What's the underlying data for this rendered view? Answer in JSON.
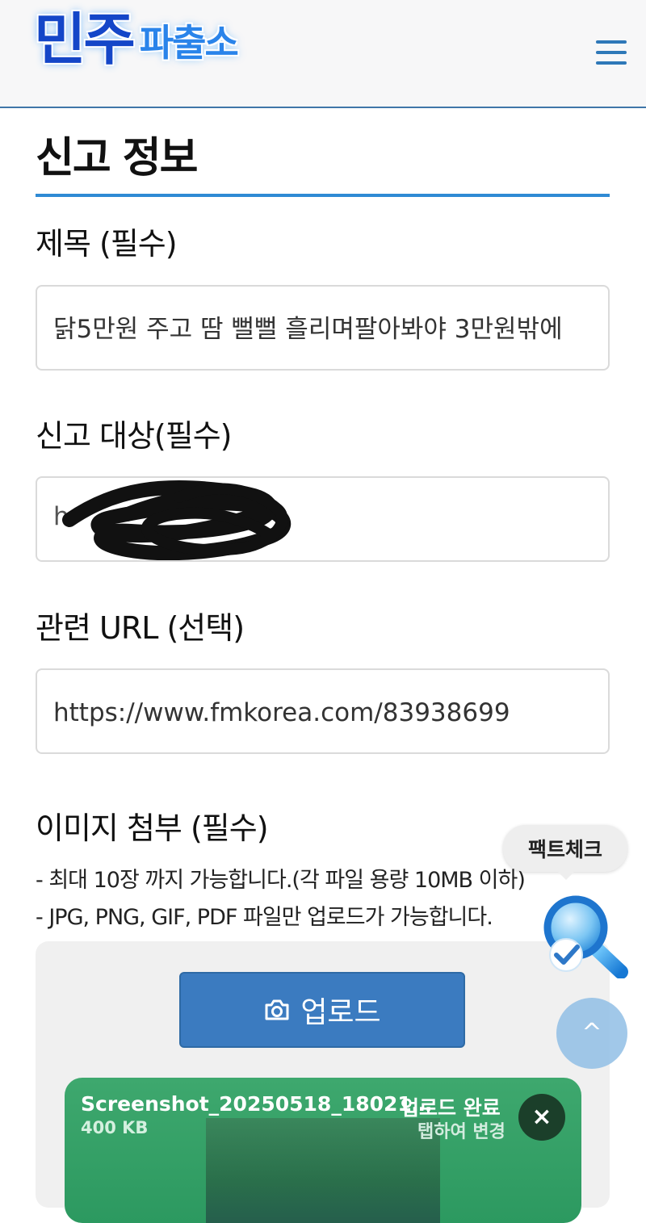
{
  "header": {
    "logo_main": "민주",
    "logo_sub": "파출소",
    "menu_icon": "hamburger-menu-icon"
  },
  "page": {
    "section_title": "신고 정보"
  },
  "form": {
    "title_label": "제목 (필수)",
    "title_value": "닭5만원 주고 땀 뻘뻘 흘리며팔아봐야 3만원밖에",
    "target_label": "신고 대상(필수)",
    "target_value_visible": "h",
    "url_label": "관련 URL (선택)",
    "url_value": "https://www.fmkorea.com/83938699",
    "image_label": "이미지 첨부 (필수)",
    "hint_1": "- 최대 10장 까지 가능합니다.(각 파일 용량 10MB 이하)",
    "hint_2": "- JPG, PNG, GIF, PDF 파일만 업로드가 가능합니다.",
    "upload_label": "업로드"
  },
  "uploaded_file": {
    "name": "Screenshot_20250518_18021…",
    "size": "400 KB",
    "status": "업로드 완료",
    "change_hint": "탭하여 변경",
    "remove_icon": "×"
  },
  "floating": {
    "factcheck_label": "팩트체크",
    "scroll_top_icon": "^"
  }
}
